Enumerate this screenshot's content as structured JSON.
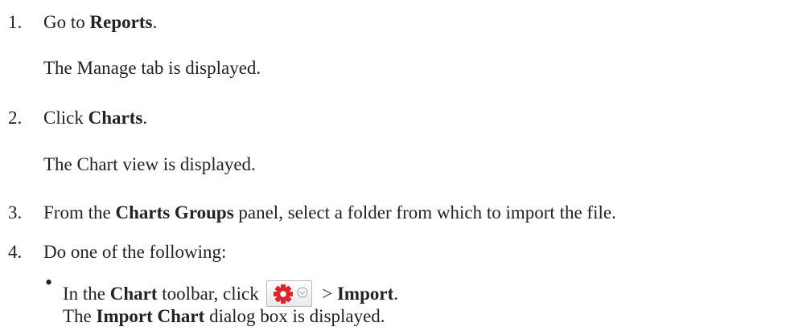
{
  "steps": [
    {
      "number": "1.",
      "pre": "Go to ",
      "bold": "Reports",
      "post": ".",
      "result": "The Manage tab is displayed."
    },
    {
      "number": "2.",
      "pre": "Click ",
      "bold": "Charts",
      "post": ".",
      "result": "The Chart view is displayed."
    },
    {
      "number": "3.",
      "pre": "From the ",
      "bold": "Charts Groups",
      "post": " panel, select a folder from which to import the file."
    },
    {
      "number": "4.",
      "text": "Do one of the following:"
    }
  ],
  "substep": {
    "bullet": "•",
    "pre": "In the ",
    "bold1": "Chart",
    "mid": " toolbar, click ",
    "sep": " > ",
    "bold2": "Import",
    "end": ".",
    "result_pre": "The ",
    "result_bold": "Import Chart",
    "result_post": " dialog box is displayed."
  },
  "icons": {
    "toolbar_button": "gear-dropdown-icon",
    "gear_color": "#e0232b"
  }
}
